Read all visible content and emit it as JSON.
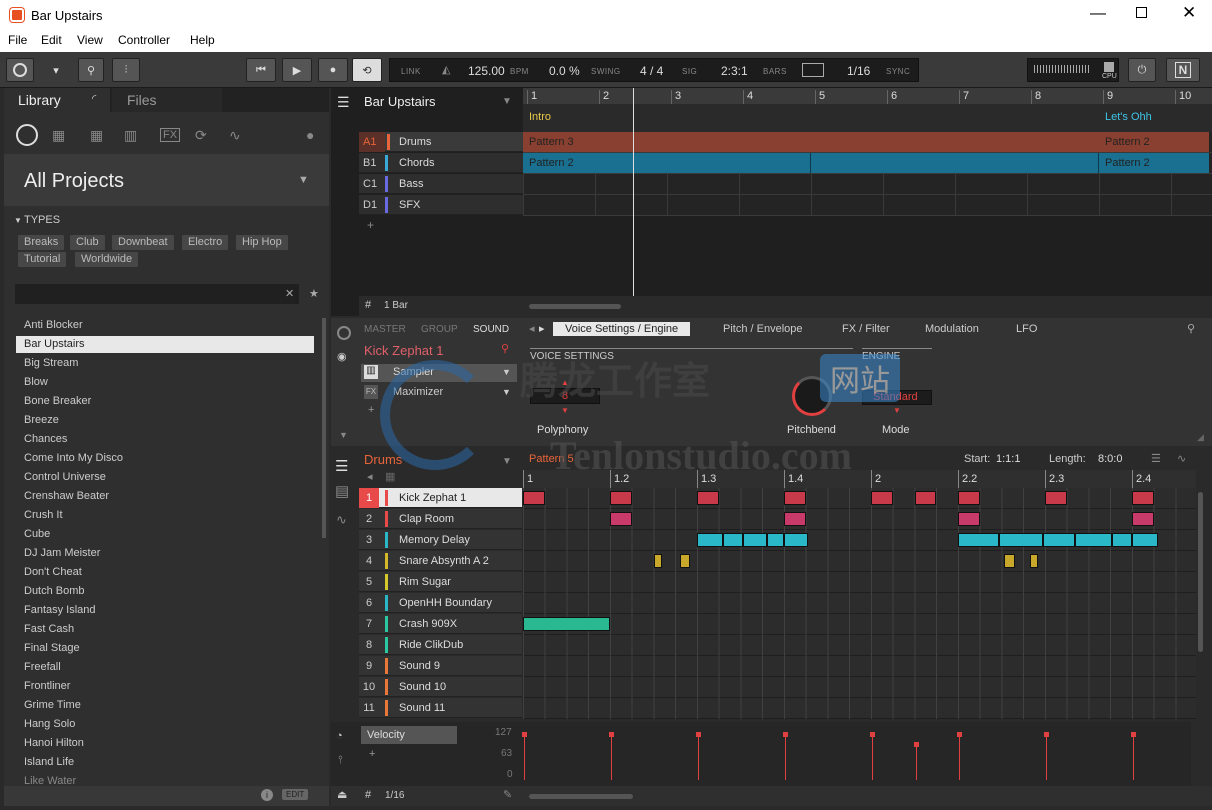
{
  "window": {
    "title": "Bar Upstairs"
  },
  "menu": [
    "File",
    "Edit",
    "View",
    "Controller",
    "Help"
  ],
  "toolbar": {
    "link": "LINK",
    "bpm": "125.00",
    "bpm_unit": "BPM",
    "swing": "0.0 %",
    "swing_unit": "SWING",
    "sig": "4 / 4",
    "sig_unit": "SIG",
    "position": "2:3:1",
    "position_unit": "BARS",
    "quant": "1/16",
    "quant_unit": "SYNC",
    "cpu": "CPU"
  },
  "library": {
    "tabs": [
      "Library",
      "Files"
    ],
    "title": "All Projects",
    "types_label": "TYPES",
    "tags": [
      "Breaks",
      "Club",
      "Downbeat",
      "Electro",
      "Hip Hop",
      "Tutorial",
      "Worldwide"
    ],
    "items": [
      "Anti Blocker",
      "Bar Upstairs",
      "Big Stream",
      "Blow",
      "Bone Breaker",
      "Breeze",
      "Chances",
      "Come Into My Disco",
      "Control Universe",
      "Crenshaw Beater",
      "Crush It",
      "Cube",
      "DJ Jam Meister",
      "Don't Cheat",
      "Dutch Bomb",
      "Fantasy Island",
      "Fast Cash",
      "Final Stage",
      "Freefall",
      "Frontliner",
      "Grime Time",
      "Hang Solo",
      "Hanoi Hilton",
      "Island Life",
      "Like Water"
    ],
    "selected_index": 1,
    "edit": "EDIT"
  },
  "arranger": {
    "project": "Bar Upstairs",
    "bars": [
      "1",
      "2",
      "3",
      "4",
      "5",
      "6",
      "7",
      "8",
      "9",
      "10"
    ],
    "sections": [
      {
        "name": "Intro",
        "color": "#e8c84a"
      },
      {
        "name": "Let's Ohh",
        "color": "#3fc4e8"
      }
    ],
    "groups": [
      {
        "code": "A1",
        "name": "Drums",
        "color": "#e8643a"
      },
      {
        "code": "B1",
        "name": "Chords",
        "color": "#3aa9d8"
      },
      {
        "code": "C1",
        "name": "Bass",
        "color": "#6a6ae0"
      },
      {
        "code": "D1",
        "name": "SFX",
        "color": "#6a6ae0"
      }
    ],
    "patterns": [
      {
        "row": 0,
        "label": "Pattern 3"
      },
      {
        "row": 0,
        "label": "Pattern 2"
      },
      {
        "row": 1,
        "label": "Pattern 2"
      },
      {
        "row": 1,
        "label": "Pattern 2"
      }
    ],
    "add": "+",
    "bar_len": "1 Bar"
  },
  "control": {
    "tabs_left": [
      "MASTER",
      "GROUP",
      "SOUND"
    ],
    "sound_name": "Kick Zephat 1",
    "plugins": [
      "Sampler",
      "Maximizer"
    ],
    "page_tabs": [
      "Voice Settings / Engine",
      "Pitch / Envelope",
      "FX / Filter",
      "Modulation",
      "LFO"
    ],
    "voice_settings": "VOICE SETTINGS",
    "engine": "ENGINE",
    "polyphony_value": "8",
    "engine_value": "Standard",
    "knobs": [
      "Polyphony",
      "Pitchbend",
      "Mode"
    ]
  },
  "pattern": {
    "group": "Drums",
    "name": "Pattern 5",
    "start_label": "Start:",
    "start": "1:1:1",
    "length_label": "Length:",
    "length": "8:0:0",
    "beats": [
      "1",
      "1.2",
      "1.3",
      "1.4",
      "2",
      "2.2",
      "2.3",
      "2.4"
    ],
    "sounds": [
      {
        "n": "1",
        "name": "Kick Zephat 1",
        "color": "#e84a4a"
      },
      {
        "n": "2",
        "name": "Clap Room",
        "color": "#e84a4a"
      },
      {
        "n": "3",
        "name": "Memory Delay",
        "color": "#2ab8c8"
      },
      {
        "n": "4",
        "name": "Snare Absynth A 2",
        "color": "#d4b82a"
      },
      {
        "n": "5",
        "name": "Rim Sugar",
        "color": "#d4c82a"
      },
      {
        "n": "6",
        "name": "OpenHH Boundary",
        "color": "#2ab8c8"
      },
      {
        "n": "7",
        "name": "Crash 909X",
        "color": "#2ac8a0"
      },
      {
        "n": "8",
        "name": "Ride ClikDub",
        "color": "#2ac8a0"
      },
      {
        "n": "9",
        "name": "Sound 9",
        "color": "#e8783a"
      },
      {
        "n": "10",
        "name": "Sound 10",
        "color": "#e8783a"
      },
      {
        "n": "11",
        "name": "Sound 11",
        "color": "#e8783a"
      }
    ],
    "velocity": "Velocity",
    "vel_max": "127",
    "vel_mid": "63",
    "vel_min": "0",
    "grid": "1/16",
    "add": "+"
  },
  "watermark": {
    "cn": "腾龙工作室",
    "site": "网站",
    "url": "Tenlonstudio.com"
  },
  "colors": {
    "kick": "#c83a4a",
    "clap": "#c83a6a",
    "delay": "#2ab8c8",
    "snare": "#c8a82a",
    "crash": "#2ab890",
    "drum_group": "#8a4030",
    "chord_group": "#1a7090"
  }
}
